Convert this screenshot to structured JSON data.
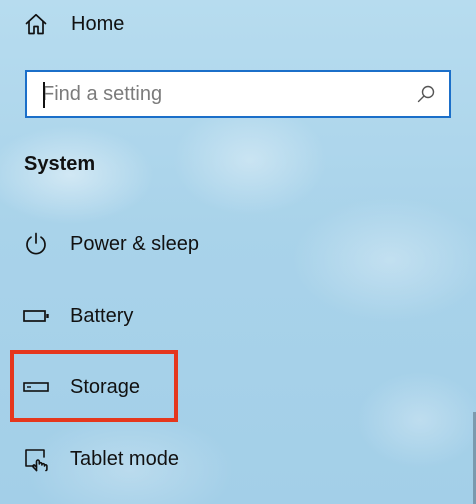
{
  "nav": {
    "home_label": "Home",
    "home_icon": "home-icon"
  },
  "search": {
    "placeholder": "Find a setting",
    "value": "",
    "icon": "search-icon"
  },
  "section": {
    "title": "System"
  },
  "items": [
    {
      "label": "Power & sleep",
      "icon": "power-icon"
    },
    {
      "label": "Battery",
      "icon": "battery-icon"
    },
    {
      "label": "Storage",
      "icon": "storage-drive-icon"
    },
    {
      "label": "Tablet mode",
      "icon": "tablet-mode-icon"
    }
  ],
  "colors": {
    "search_border": "#1b6fc9",
    "highlight": "#e5371d",
    "background": "#a9d3ea"
  }
}
